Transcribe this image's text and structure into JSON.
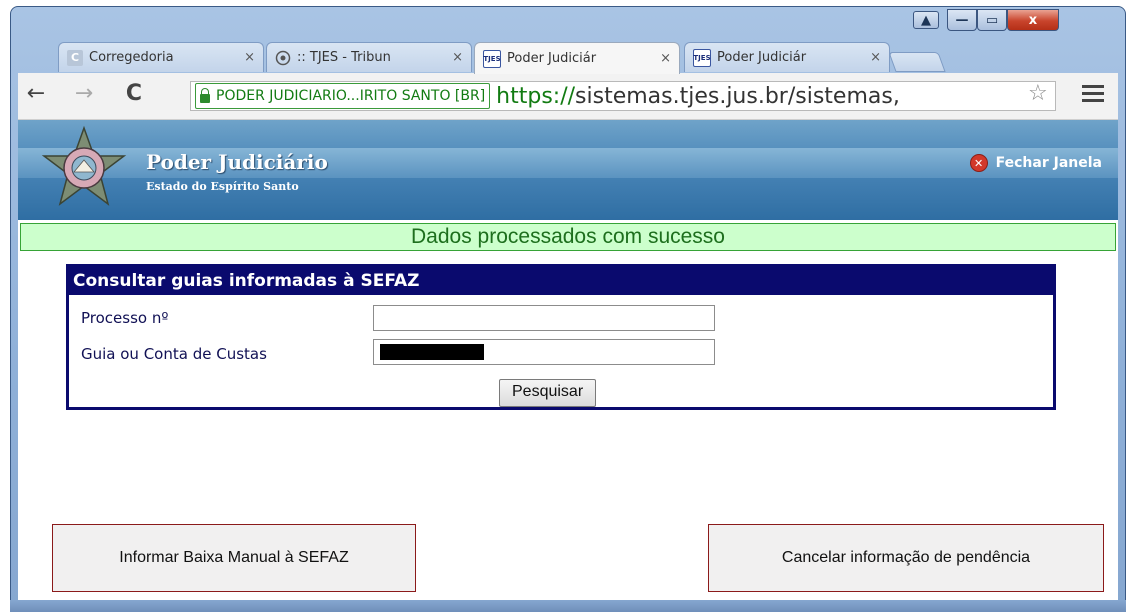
{
  "window": {
    "controls": {
      "close_glyph": "x",
      "min_glyph": "—",
      "max_glyph": "▭",
      "user_glyph": "▲"
    }
  },
  "tabs": [
    {
      "label": "Corregedoria",
      "close": "×",
      "favicon": "C",
      "active": false
    },
    {
      "label": ":: TJES - Tribun",
      "close": "×",
      "favicon": "seal",
      "active": false
    },
    {
      "label": "Poder Judiciár",
      "close": "×",
      "favicon": "TJES",
      "active": true
    },
    {
      "label": "Poder Judiciár",
      "close": "×",
      "favicon": "TJES",
      "active": false
    }
  ],
  "toolbar": {
    "back": "←",
    "forward": "→",
    "reload": "C",
    "ev_label": "PODER JUDICIARIO...IRITO SANTO [BR]",
    "url_scheme": "https://",
    "url_rest": "sistemas.tjes.jus.br/sistemas,",
    "star": "☆"
  },
  "header": {
    "title": "Poder Judiciário",
    "subtitle": "Estado do Espírito Santo",
    "close_label": "Fechar Janela"
  },
  "status": {
    "message": "Dados processados com sucesso"
  },
  "form": {
    "title": "Consultar guias informadas à SEFAZ",
    "processo_label": "Processo nº",
    "processo_value": "",
    "guia_label": "Guia ou Conta de Custas",
    "guia_value": "",
    "search_button": "Pesquisar"
  },
  "actions": {
    "manual_label": "Informar Baixa Manual à SEFAZ",
    "cancel_label": "Cancelar informação de pendência"
  },
  "colors": {
    "success_bg": "#ccffcc",
    "panel_navy": "#0a0a6e",
    "header_blue": "#4a86b8",
    "button_border": "#8b1a1a"
  }
}
